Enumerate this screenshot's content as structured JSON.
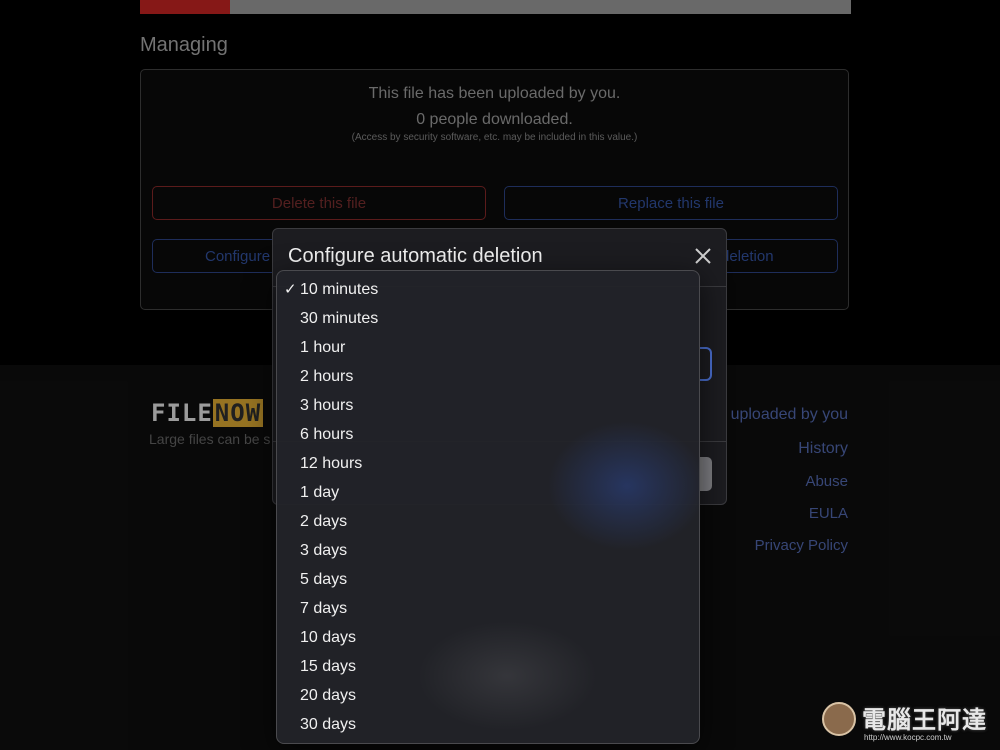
{
  "progress": {
    "fraction": 0.126
  },
  "managing": {
    "title": "Managing",
    "uploaded_by_you": "This file has been uploaded by you.",
    "downloads": "0 people downloaded.",
    "note": "(Access by security software, etc. may be included in this value.)",
    "delete_label": "Delete this file",
    "replace_label": "Replace this file",
    "configure_label": "Configure",
    "deletion_label": "deletion"
  },
  "footer": {
    "logo_file": "FILE",
    "logo_now": "NOW",
    "tagline": "Large files can be s",
    "links": {
      "uploaded": "uploaded by you",
      "history": "History",
      "abuse": "Abuse",
      "eula": "EULA",
      "privacy": "Privacy Policy"
    }
  },
  "modal": {
    "title": "Configure automatic deletion",
    "close_icon": "close-icon"
  },
  "dropdown": {
    "selected_index": 0,
    "check_mark": "✓",
    "options": [
      "10 minutes",
      "30 minutes",
      "1 hour",
      "2 hours",
      "3 hours",
      "6 hours",
      "12 hours",
      "1 day",
      "2 days",
      "3 days",
      "5 days",
      "7 days",
      "10 days",
      "15 days",
      "20 days",
      "30 days"
    ]
  },
  "watermark": {
    "title": "電腦王阿達",
    "url": "http://www.kocpc.com.tw"
  },
  "colors": {
    "progress_fill": "#b3201f",
    "danger": "#7a2525",
    "primary": "#2e4a91",
    "logo_accent": "#c99a2e"
  }
}
